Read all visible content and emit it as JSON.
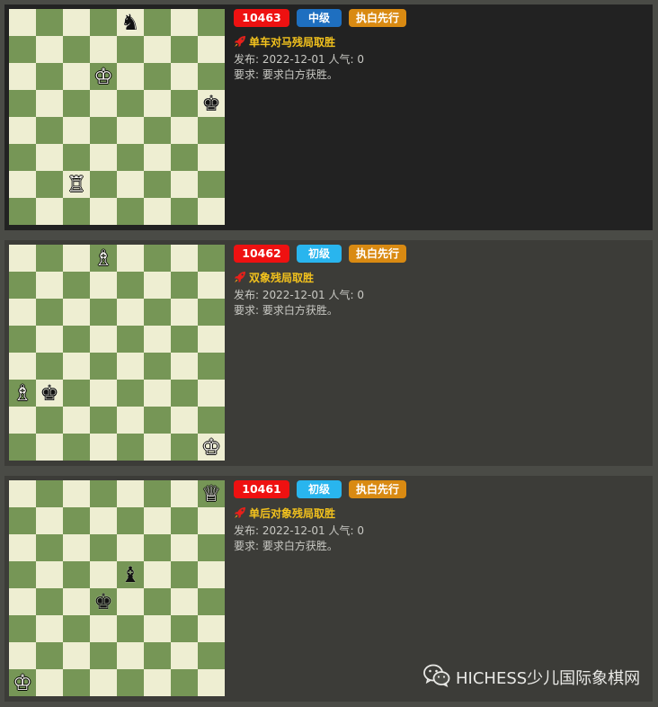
{
  "puzzles": [
    {
      "id": "10463",
      "level": "中级",
      "level_color": "#1e6fc0",
      "turn": "执白先行",
      "title": "单车对马残局取胜",
      "publish_label": "发布:",
      "date": "2022-12-01",
      "pop_label": "人气:",
      "popularity": "0",
      "req_label": "要求:",
      "requirement": "要求白方获胜。",
      "pieces": [
        {
          "sq": "e8",
          "glyph": "♞",
          "color": "b",
          "icon": "black-knight-icon"
        },
        {
          "sq": "d6",
          "glyph": "♔",
          "color": "w",
          "icon": "white-king-icon"
        },
        {
          "sq": "h5",
          "glyph": "♚",
          "color": "b",
          "icon": "black-king-icon"
        },
        {
          "sq": "c2",
          "glyph": "♖",
          "color": "w",
          "icon": "white-rook-icon"
        }
      ]
    },
    {
      "id": "10462",
      "level": "初级",
      "level_color": "#29b5ee",
      "turn": "执白先行",
      "title": "双象残局取胜",
      "publish_label": "发布:",
      "date": "2022-12-01",
      "pop_label": "人气:",
      "popularity": "0",
      "req_label": "要求:",
      "requirement": "要求白方获胜。",
      "pieces": [
        {
          "sq": "d8",
          "glyph": "♗",
          "color": "w",
          "icon": "white-bishop-icon"
        },
        {
          "sq": "a3",
          "glyph": "♗",
          "color": "w",
          "icon": "white-bishop-icon"
        },
        {
          "sq": "b3",
          "glyph": "♚",
          "color": "b",
          "icon": "black-king-icon"
        },
        {
          "sq": "h1",
          "glyph": "♔",
          "color": "w",
          "icon": "white-king-icon"
        }
      ]
    },
    {
      "id": "10461",
      "level": "初级",
      "level_color": "#29b5ee",
      "turn": "执白先行",
      "title": "单后对象残局取胜",
      "publish_label": "发布:",
      "date": "2022-12-01",
      "pop_label": "人气:",
      "popularity": "0",
      "req_label": "要求:",
      "requirement": "要求白方获胜。",
      "pieces": [
        {
          "sq": "h8",
          "glyph": "♕",
          "color": "w",
          "icon": "white-queen-icon"
        },
        {
          "sq": "e5",
          "glyph": "♝",
          "color": "b",
          "icon": "black-bishop-icon"
        },
        {
          "sq": "d4",
          "glyph": "♚",
          "color": "b",
          "icon": "black-king-icon"
        },
        {
          "sq": "a1",
          "glyph": "♔",
          "color": "w",
          "icon": "white-king-icon"
        }
      ]
    }
  ],
  "watermark": {
    "icon": "wechat-icon",
    "text": "HICHESS少儿国际象棋网"
  },
  "colors": {
    "light_square": "#eeeed2",
    "dark_square": "#769656",
    "id_badge": "#ee1111",
    "turn_badge": "#d98a12",
    "title_text": "#f3c21d"
  }
}
